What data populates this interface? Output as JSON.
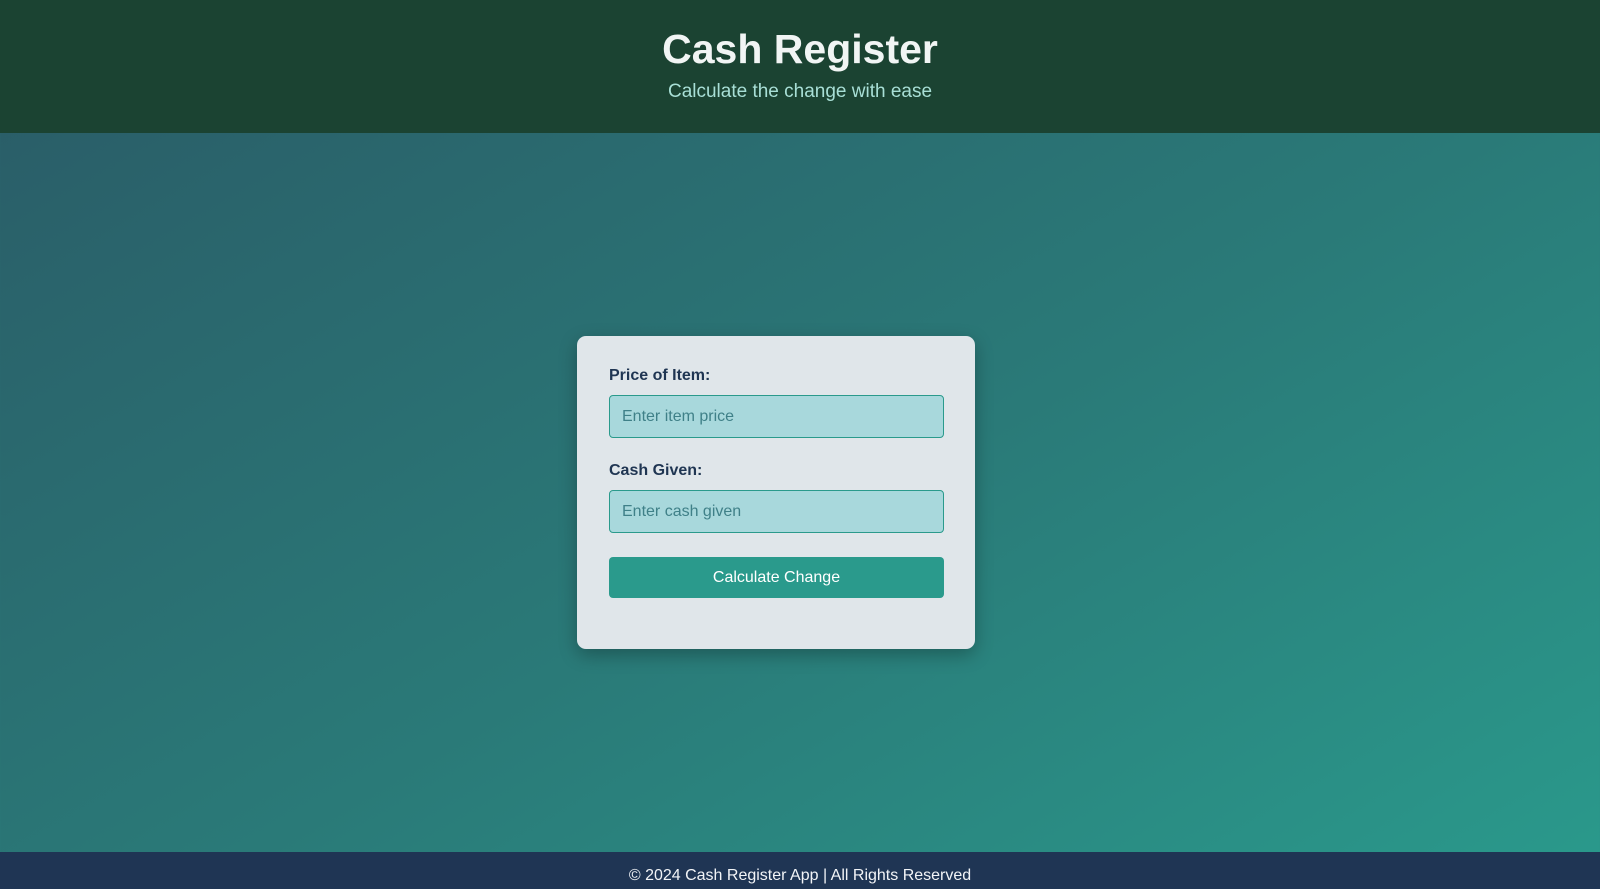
{
  "header": {
    "title": "Cash Register",
    "subtitle": "Calculate the change with ease"
  },
  "form": {
    "price_label": "Price of Item:",
    "price_placeholder": "Enter item price",
    "price_value": "",
    "cash_label": "Cash Given:",
    "cash_placeholder": "Enter cash given",
    "cash_value": "",
    "submit_label": "Calculate Change"
  },
  "footer": {
    "text": "© 2024 Cash Register App | All Rights Reserved"
  },
  "colors": {
    "header_bg": "#1b4332",
    "accent": "#2a9a8c",
    "footer_bg": "#1f3554",
    "card_bg": "#e0e6ea"
  }
}
